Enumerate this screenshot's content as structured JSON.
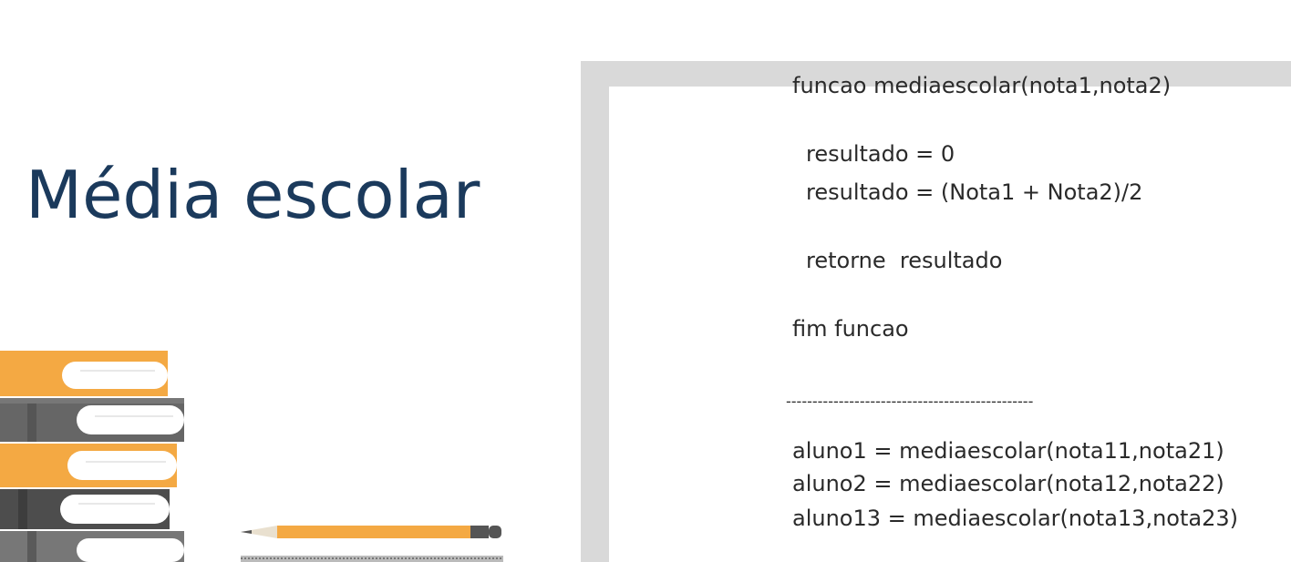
{
  "slide": {
    "title": "Média escolar",
    "code": {
      "line1": "funcao mediaescolar(nota1,nota2)",
      "line2": "resultado = 0",
      "line3": "resultado = (Nota1 + Nota2)/2",
      "line4": "retorne  resultado",
      "line5": "fim funcao",
      "divider": "-----------------------------------------------",
      "line6": "aluno1 = mediaescolar(nota11,nota21)",
      "line7": "aluno2 = mediaescolar(nota12,nota22)",
      "line8": "aluno13 = mediaescolar(nota13,nota23)"
    }
  },
  "colors": {
    "title": "#1b3a5c",
    "book_orange": "#f4a943",
    "book_gray": "#6a6a6a",
    "frame": "#d9d9d9"
  },
  "icons": [
    "books-illustration",
    "pencil-illustration"
  ]
}
